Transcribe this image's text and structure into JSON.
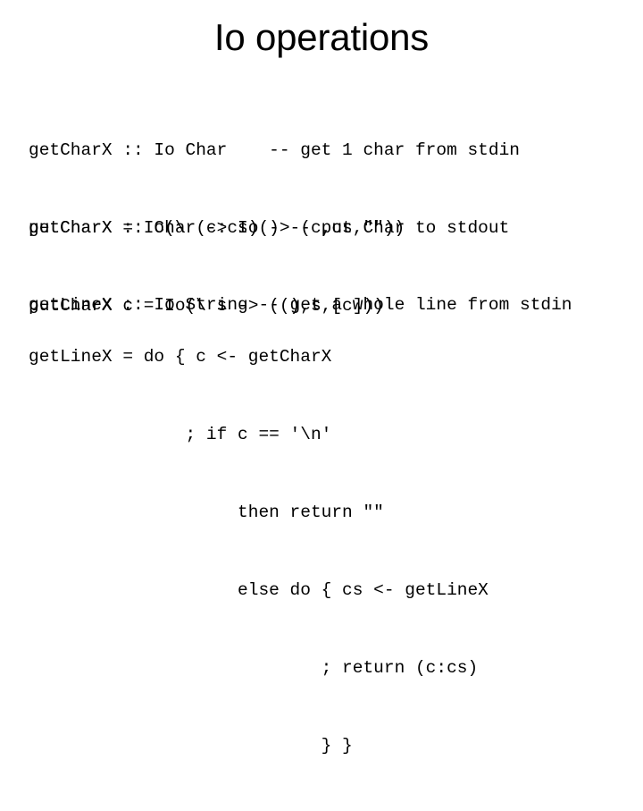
{
  "slide": {
    "title": "Io operations",
    "code_blocks": [
      {
        "id": "getchar",
        "lines": [
          "getCharX :: Io Char    -- get 1 char from stdin",
          "getCharX = Io(\\ (c:cs) -> (c,cs,\"\"))"
        ]
      },
      {
        "id": "putchar",
        "lines": [
          "putCharX :: Char -> Io() -- put Char to stdout",
          "putCharX c = Io(\\ s -> ((),s,[c]))"
        ]
      },
      {
        "id": "getline-sig",
        "lines": [
          "getLineX :: Io String -- get a whole line from stdin"
        ]
      },
      {
        "id": "getline-def",
        "lines": [
          "getLineX = do { c <- getCharX",
          "               ; if c == '\\n'",
          "                    then return \"\"",
          "                    else do { cs <- getLineX",
          "                            ; return (c:cs)",
          "                            } }"
        ]
      }
    ]
  }
}
